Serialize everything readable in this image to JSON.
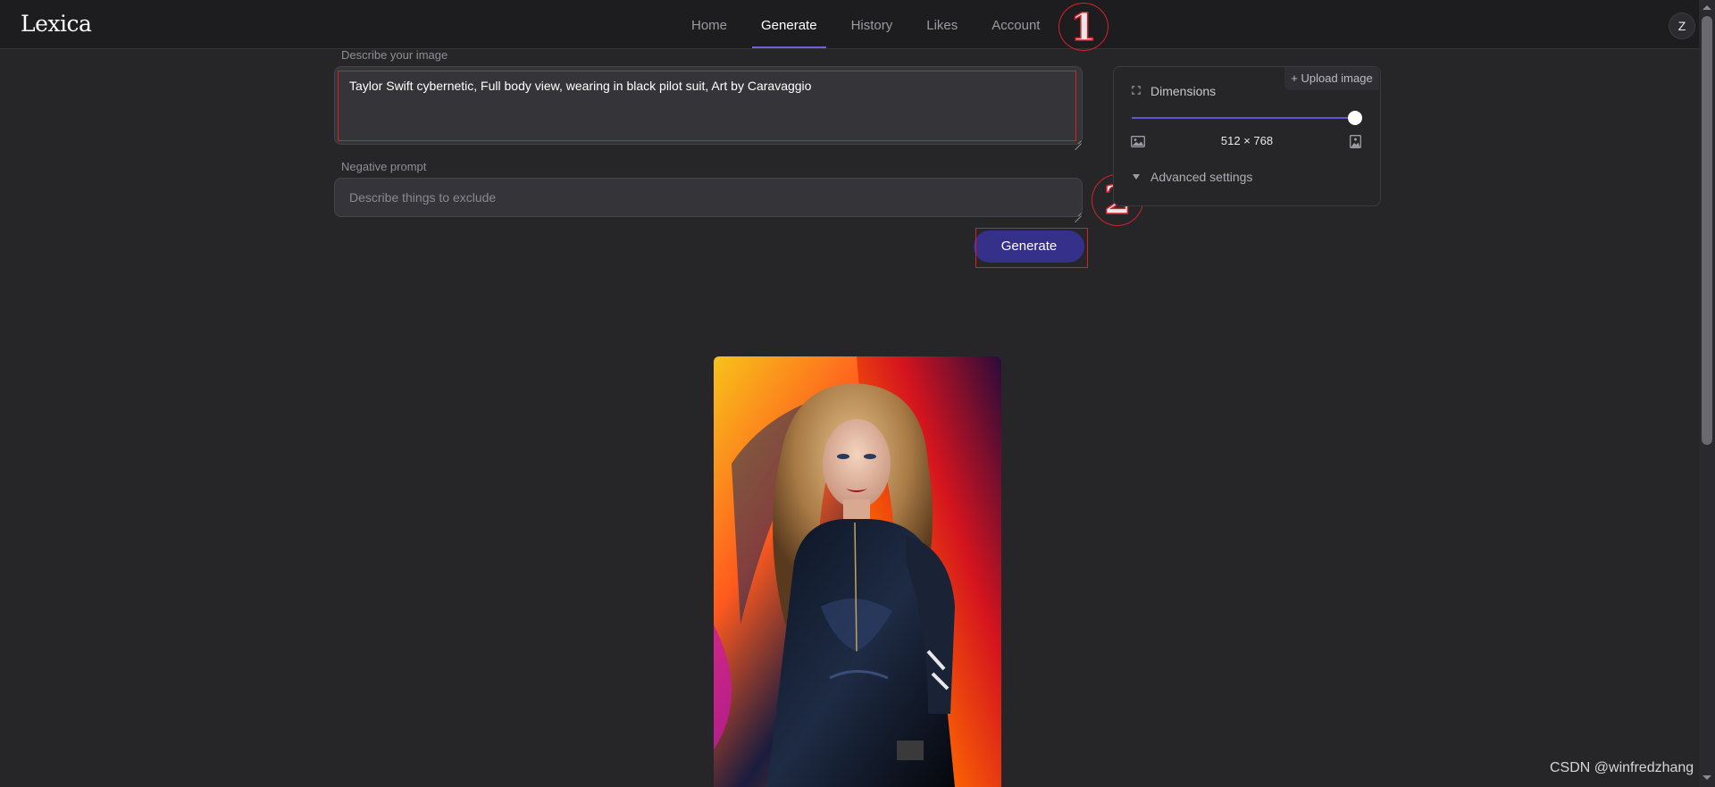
{
  "app": {
    "logo": "Lexica",
    "avatar_initial": "Z"
  },
  "nav": {
    "items": [
      {
        "label": "Home",
        "active": false
      },
      {
        "label": "Generate",
        "active": true
      },
      {
        "label": "History",
        "active": false
      },
      {
        "label": "Likes",
        "active": false
      },
      {
        "label": "Account",
        "active": false
      }
    ],
    "accent": "#6c5fe0"
  },
  "annotations": {
    "one": "1",
    "two": "2",
    "color": "#d2232a"
  },
  "form": {
    "prompt_label": "Describe your image",
    "prompt_value": "Taylor Swift cybernetic, Full body view, wearing in black pilot suit, Art by Caravaggio",
    "negative_label": "Negative prompt",
    "negative_placeholder": "Describe things to exclude",
    "generate_label": "Generate"
  },
  "settings": {
    "upload_label": "+ Upload image",
    "dimensions_label": "Dimensions",
    "dimensions_value": "512 × 768",
    "slider_level": 1.0,
    "advanced_label": "Advanced settings"
  },
  "watermark": "CSDN @winfredzhang",
  "icons": {
    "dimensions": "expand-icon",
    "landscape": "landscape-image-icon",
    "portrait": "portrait-image-icon",
    "advanced": "caret-down-icon"
  }
}
